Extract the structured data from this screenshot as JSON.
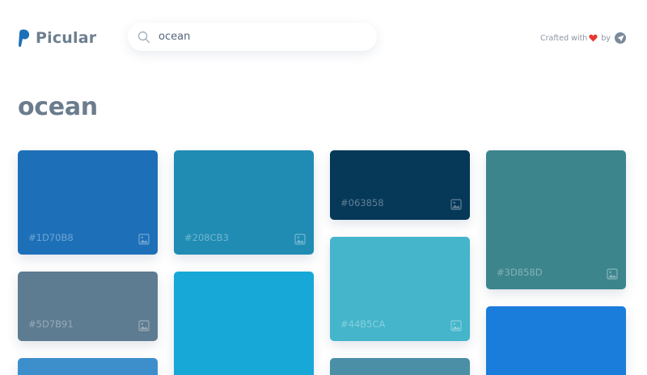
{
  "app": {
    "name": "Picular"
  },
  "search": {
    "value": "ocean",
    "placeholder": ""
  },
  "credit": {
    "crafted_with": "Crafted with",
    "by": "by"
  },
  "page": {
    "title": "ocean"
  },
  "colors": {
    "logo": "#1d70b8",
    "text": "#6b7c8d"
  },
  "tiles": [
    {
      "hex": "#1D70B8",
      "color": "#1D70B8",
      "label": "#1D70B8"
    },
    {
      "hex": "#5D7B91",
      "color": "#5D7B91",
      "label": "#5D7B91"
    },
    {
      "hex": "#3C8FCB",
      "color": "#3C8FCB",
      "label": ""
    },
    {
      "hex": "#208CB3",
      "color": "#208CB3",
      "label": "#208CB3"
    },
    {
      "hex": "#17A8D8",
      "color": "#17A8D8",
      "label": ""
    },
    {
      "hex": "#063858",
      "color": "#063858",
      "label": "#063858"
    },
    {
      "hex": "#44B5CA",
      "color": "#44B5CA",
      "label": "#44B5CA"
    },
    {
      "hex": "#4A8FA6",
      "color": "#4A8FA6",
      "label": ""
    },
    {
      "hex": "#3D858D",
      "color": "#3D858D",
      "label": "#3D858D"
    },
    {
      "hex": "#1A7CDB",
      "color": "#1A7CDB",
      "label": ""
    }
  ]
}
